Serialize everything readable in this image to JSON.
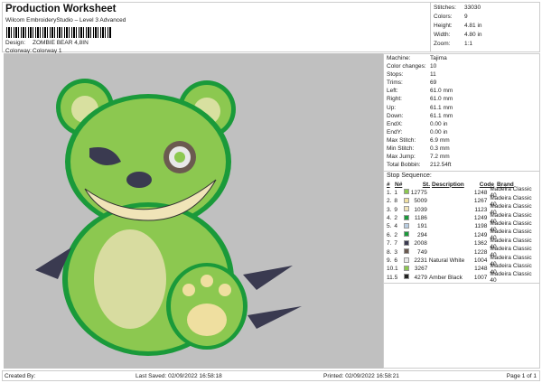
{
  "header": {
    "title": "Production Worksheet",
    "subtitle": "Wilcom EmbroideryStudio – Level 3 Advanced",
    "design_label": "Design:",
    "design_value": "ZOMBIE BEAR 4,8IN",
    "colorway_label": "Colorway:",
    "colorway_value": "Colorway 1"
  },
  "stats": [
    {
      "label": "Stitches:",
      "value": "33030"
    },
    {
      "label": "Colors:",
      "value": "9"
    },
    {
      "label": "Height:",
      "value": "4.81 in"
    },
    {
      "label": "Width:",
      "value": "4.80 in"
    },
    {
      "label": "Zoom:",
      "value": "1:1"
    }
  ],
  "details": [
    {
      "label": "Machine:",
      "value": "Tajima"
    },
    {
      "label": "Color changes:",
      "value": "10"
    },
    {
      "label": "Stops:",
      "value": "11"
    },
    {
      "label": "Trims:",
      "value": "69"
    },
    {
      "label": "Left:",
      "value": "61.0 mm"
    },
    {
      "label": "Right:",
      "value": "61.0 mm"
    },
    {
      "label": "Up:",
      "value": "61.1 mm"
    },
    {
      "label": "Down:",
      "value": "61.1 mm"
    },
    {
      "label": "EndX:",
      "value": "0.00 in"
    },
    {
      "label": "EndY:",
      "value": "0.00 in"
    },
    {
      "label": "Max Stitch:",
      "value": "6.9 mm"
    },
    {
      "label": "Min Stitch:",
      "value": "0.3 mm"
    },
    {
      "label": "Max Jump:",
      "value": "7.2 mm"
    },
    {
      "label": "Total Bobbin:",
      "value": "212.54ft"
    }
  ],
  "stop_sequence": {
    "title": "Stop Sequence:",
    "headers": [
      "#",
      "N#",
      "St.",
      "Description",
      "Code",
      "Brand"
    ],
    "rows": [
      {
        "n": "1.",
        "nn": "1",
        "color": "#8cc850",
        "st": "12775",
        "desc": "",
        "code": "1248",
        "brand": "Madeira Classic 40"
      },
      {
        "n": "2.",
        "nn": "8",
        "color": "#efdfa0",
        "st": "5009",
        "desc": "",
        "code": "1267",
        "brand": "Madeira Classic 40"
      },
      {
        "n": "3.",
        "nn": "9",
        "color": "#f0e4b8",
        "st": "1039",
        "desc": "",
        "code": "1123",
        "brand": "Madeira Classic 40"
      },
      {
        "n": "4.",
        "nn": "2",
        "color": "#1a9a3a",
        "st": "1186",
        "desc": "",
        "code": "1249",
        "brand": "Madeira Classic 40"
      },
      {
        "n": "5.",
        "nn": "4",
        "color": "#b8cce0",
        "st": "191",
        "desc": "",
        "code": "1198",
        "brand": "Madeira Classic 40"
      },
      {
        "n": "6.",
        "nn": "2",
        "color": "#1a9a3a",
        "st": "294",
        "desc": "",
        "code": "1249",
        "brand": "Madeira Classic 40"
      },
      {
        "n": "7.",
        "nn": "7",
        "color": "#3a3a50",
        "st": "2008",
        "desc": "",
        "code": "1362",
        "brand": "Madeira Classic 40"
      },
      {
        "n": "8.",
        "nn": "3",
        "color": "#6b5a50",
        "st": "749",
        "desc": "",
        "code": "1228",
        "brand": "Madeira Classic 40"
      },
      {
        "n": "9.",
        "nn": "6",
        "color": "#e8e8e8",
        "st": "2231",
        "desc": "Natural White",
        "code": "1004",
        "brand": "Madeira Classic 40"
      },
      {
        "n": "10.",
        "nn": "1",
        "color": "#8cc850",
        "st": "3267",
        "desc": "",
        "code": "1248",
        "brand": "Madeira Classic 40"
      },
      {
        "n": "11.",
        "nn": "5",
        "color": "#222222",
        "st": "4279",
        "desc": "Amber Black",
        "code": "1007",
        "brand": "Madeira Classic 40"
      }
    ]
  },
  "footer": {
    "created_by": "Created By:",
    "last_saved": "Last Saved: 02/09/2022 16:58:18",
    "printed": "Printed: 02/09/2022 16:58:21",
    "page": "Page 1 of 1"
  }
}
